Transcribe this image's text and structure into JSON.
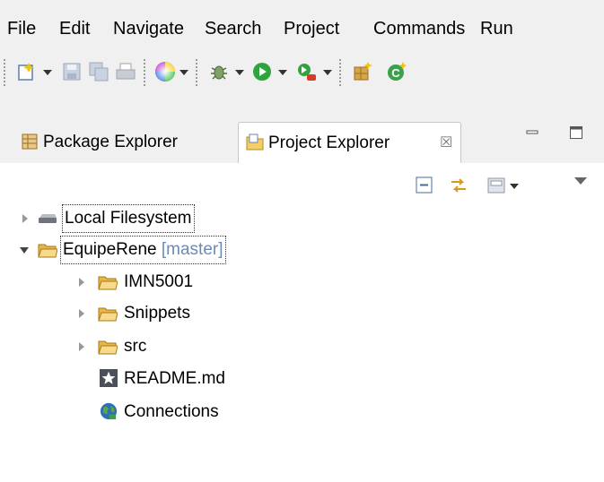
{
  "menu": {
    "items": [
      "File",
      "Edit",
      "Navigate",
      "Search",
      "Project",
      "Commands",
      "Run"
    ]
  },
  "toolbar": {
    "icons": [
      "new-icon",
      "save-icon",
      "save-all-icon",
      "print-icon",
      "color-wheel-icon",
      "debug-icon",
      "run-icon",
      "external-tools-icon",
      "new-package-icon",
      "new-class-icon"
    ]
  },
  "tabs": [
    {
      "label": "Package Explorer",
      "icon": "package-explorer-icon",
      "active": false
    },
    {
      "label": "Project Explorer",
      "icon": "project-explorer-icon",
      "active": true,
      "close": "☒"
    }
  ],
  "view_toolbar": {
    "icons": [
      "collapse-all-icon",
      "link-with-editor-icon",
      "filters-icon",
      "view-menu-icon"
    ]
  },
  "tree": {
    "local_fs": "Local Filesystem",
    "project": "EquipeRene",
    "branch": "[master]",
    "children": [
      "IMN5001",
      "Snippets",
      "src"
    ],
    "readme": "README.md",
    "connections": "Connections"
  },
  "colors": {
    "chrome_bg": "#f0f0f0",
    "content_bg": "#ffffff",
    "decoration": "#6b8bb4",
    "folder": "#e8b64a"
  }
}
